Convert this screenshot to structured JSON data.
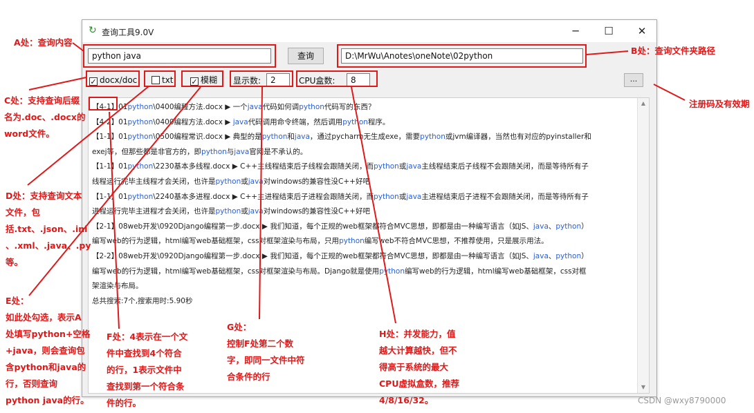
{
  "window": {
    "title": "查询工具9.0V",
    "controls": {
      "minimize": "─",
      "maximize": "☐",
      "close": "✕"
    }
  },
  "query": {
    "value": "python java",
    "button": "查询",
    "folder_path": "D:\\MrWu\\Anotes\\oneNote\\02python"
  },
  "options": {
    "docx_label": "docx/doc",
    "docx_checked": true,
    "txt_label": "txt",
    "txt_checked": false,
    "fuzzy_label": "模糊",
    "fuzzy_checked": true,
    "display_count_label": "显示数:",
    "display_count_value": "2",
    "cpu_label": "CPU盒数:",
    "cpu_value": "8",
    "register_button": "..."
  },
  "results": [
    [
      {
        "t": "【4-1】01"
      },
      {
        "t": "python",
        "k": 1
      },
      {
        "t": "\\0400编程方法.docx ▶ 一个"
      },
      {
        "t": "java",
        "k": 1
      },
      {
        "t": "代码如何调"
      },
      {
        "t": "python",
        "k": 1
      },
      {
        "t": "代码写的东西？"
      }
    ],
    [
      {
        "t": "【4-2】01"
      },
      {
        "t": "python",
        "k": 1
      },
      {
        "t": "\\0400编程方法.docx ▶ "
      },
      {
        "t": "java",
        "k": 1
      },
      {
        "t": "代码调用命令终端，然后调用"
      },
      {
        "t": "python",
        "k": 1
      },
      {
        "t": "程序。"
      }
    ],
    [
      {
        "t": "【1-1】01"
      },
      {
        "t": "python",
        "k": 1
      },
      {
        "t": "\\0500编程常识.docx ▶ 典型的是"
      },
      {
        "t": "python",
        "k": 1
      },
      {
        "t": "和"
      },
      {
        "t": "java",
        "k": 1
      },
      {
        "t": "，通过pycharm无生成exe，需要"
      },
      {
        "t": "python",
        "k": 1
      },
      {
        "t": "或jvm编译器，当然也有对应的pyinstaller和"
      }
    ],
    [
      {
        "t": "exej等，但那些都是非官方的，即"
      },
      {
        "t": "python",
        "k": 1
      },
      {
        "t": "与"
      },
      {
        "t": "java",
        "k": 1
      },
      {
        "t": "官网是不承认的。"
      }
    ],
    [
      {
        "t": "【1-1】01"
      },
      {
        "t": "python",
        "k": 1
      },
      {
        "t": "\\2230基本多线程.docx ▶ C++主线程结束后子线程会跟随关闭，而"
      },
      {
        "t": "python",
        "k": 1
      },
      {
        "t": "或"
      },
      {
        "t": "java",
        "k": 1
      },
      {
        "t": "主线程结束后子线程不会跟随关闭，而是等待所有子"
      }
    ],
    [
      {
        "t": "线程运行完毕主线程才会关闭，也许是"
      },
      {
        "t": "python",
        "k": 1
      },
      {
        "t": "或"
      },
      {
        "t": "java",
        "k": 1
      },
      {
        "t": "对windows的兼容性没C++好吧"
      }
    ],
    [
      {
        "t": "【1-1】01"
      },
      {
        "t": "python",
        "k": 1
      },
      {
        "t": "\\2240基本多进程.docx ▶ C++主进程结束后子进程会跟随关闭，而"
      },
      {
        "t": "python",
        "k": 1
      },
      {
        "t": "或"
      },
      {
        "t": "java",
        "k": 1
      },
      {
        "t": "主进程结束后子进程不会跟随关闭，而是等待所有子"
      }
    ],
    [
      {
        "t": "进程运行完毕主进程才会关闭，也许是"
      },
      {
        "t": "python",
        "k": 1
      },
      {
        "t": "或"
      },
      {
        "t": "java",
        "k": 1
      },
      {
        "t": "对windows的兼容性没C++好吧"
      }
    ],
    [
      {
        "t": "【2-1】08web开发\\0920Django编程第一步.docx ▶ 我们知道，每个正规的web框架都符合MVC思想，即都是由一种编写语言（如JS、"
      },
      {
        "t": "java",
        "k": 1
      },
      {
        "t": "、"
      },
      {
        "t": "python",
        "k": 1
      },
      {
        "t": "）"
      }
    ],
    [
      {
        "t": "编写web的行为逻辑，html编写web基础框架，css对框架渲染与布局，只用"
      },
      {
        "t": "python",
        "k": 1
      },
      {
        "t": "编写web不符合MVC思想，不推荐使用，只是展示用法。"
      }
    ],
    [
      {
        "t": "【2-2】08web开发\\0920Django编程第一步.docx ▶ 我们知道，每个正规的web框架都符合MVC思想，即都是由一种编写语言（如JS、"
      },
      {
        "t": "java",
        "k": 1
      },
      {
        "t": "、"
      },
      {
        "t": "python",
        "k": 1
      },
      {
        "t": "）"
      }
    ],
    [
      {
        "t": "编写web的行为逻辑，html编写web基础框架，css对框架渲染与布局。Django就是使用"
      },
      {
        "t": "python",
        "k": 1
      },
      {
        "t": "编写web的行为逻辑，html编写web基础框架，css对框"
      }
    ],
    [
      {
        "t": "架渲染与布局。"
      }
    ],
    [
      {
        "t": "总共搜索:7个,搜索用时:5.90秒"
      }
    ]
  ],
  "annotations": {
    "a": [
      "A处：查询内容"
    ],
    "b": [
      "B处：查询文件夹路径"
    ],
    "register": [
      "注册码及有效期"
    ],
    "c": [
      "C处：支持查询后缀",
      "名为.doc、.docx的",
      "word文件。"
    ],
    "d": [
      "D处：支持查询文本",
      "文件，包",
      "括.txt、.json、.ini",
      "、.xml、.java、.py",
      "等。"
    ],
    "e": [
      "E处：",
      "如此处勾选，表示A",
      "处填写python+空格",
      "+java，则会查询包",
      "含python和java的",
      "行，否则查询",
      "python java的行。"
    ],
    "f": [
      "F处：4表示在一个文",
      "件中查找到4个符合",
      "的行，1表示文件中",
      "查找到第一个符合条",
      "件的行。"
    ],
    "g": [
      "G处：",
      "控制F处第二个数",
      "字，即同一文件中符",
      "合条件的行"
    ],
    "h": [
      "H处：并发能力，值",
      "越大计算越快，但不",
      "得高于系统的最大",
      "CPU虚拟盒数，推荐",
      "4/8/16/32。"
    ]
  },
  "watermark": "CSDN @wxy8790000"
}
